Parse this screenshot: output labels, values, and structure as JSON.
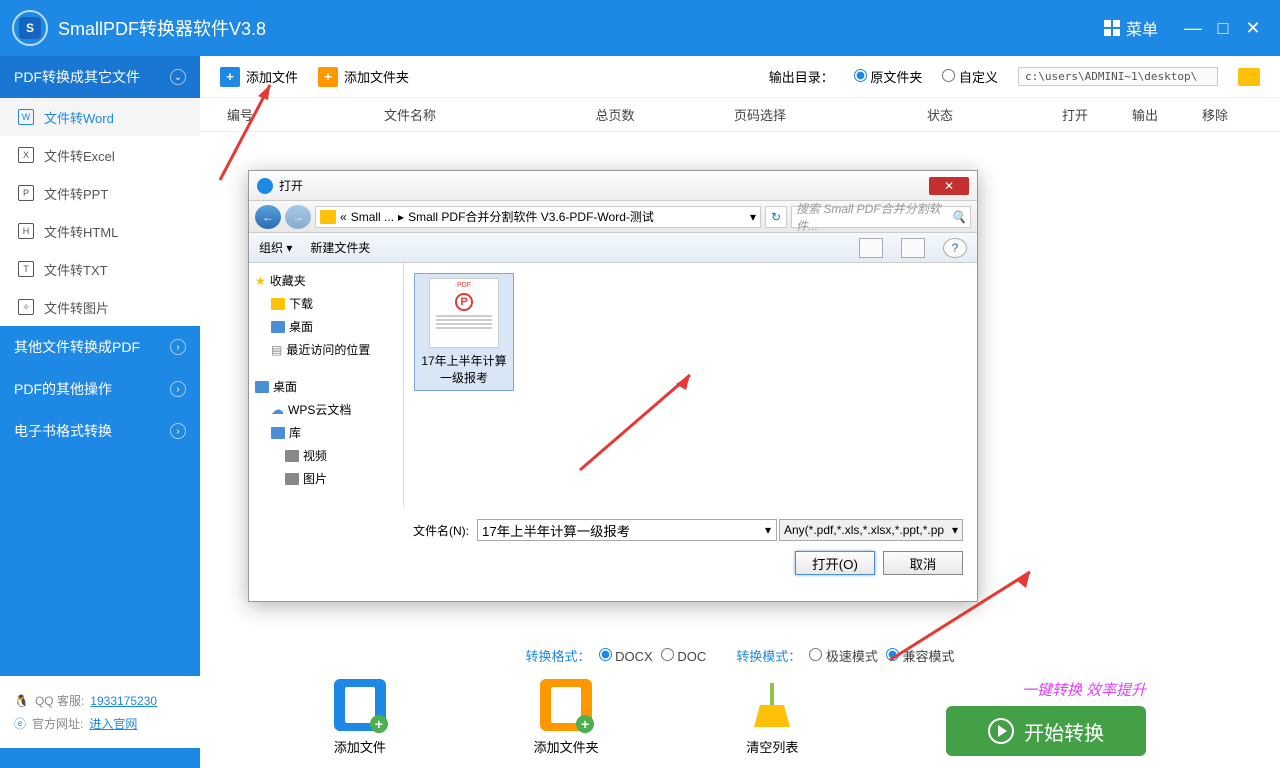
{
  "app": {
    "title": "SmallPDF转换器软件V3.8",
    "menu": "菜单"
  },
  "sidebar": {
    "cat1": "PDF转换成其它文件",
    "items": [
      {
        "label": "文件转Word",
        "glyph": "W"
      },
      {
        "label": "文件转Excel",
        "glyph": "X"
      },
      {
        "label": "文件转PPT",
        "glyph": "P"
      },
      {
        "label": "文件转HTML",
        "glyph": "H"
      },
      {
        "label": "文件转TXT",
        "glyph": "T"
      },
      {
        "label": "文件转图片",
        "glyph": "✧"
      }
    ],
    "cat2": "其他文件转换成PDF",
    "cat3": "PDF的其他操作",
    "cat4": "电子书格式转换",
    "qq_label": "QQ 客服:",
    "qq": "1933175230",
    "site_label": "官方网址:",
    "site": "进入官网"
  },
  "toolbar": {
    "add_file": "添加文件",
    "add_folder": "添加文件夹",
    "output_label": "输出目录：",
    "opt1": "原文件夹",
    "opt2": "自定义",
    "path": "c:\\users\\ADMINI~1\\desktop\\"
  },
  "table": {
    "h1": "编号",
    "h2": "文件名称",
    "h3": "总页数",
    "h4": "页码选择",
    "h5": "状态",
    "h6": "打开",
    "h7": "输出",
    "h8": "移除"
  },
  "dialog": {
    "title": "打开",
    "crumb1": "Small ...",
    "crumb2": "Small PDF合并分割软件 V3.6-PDF-Word-测试",
    "search_placeholder": "搜索 Small PDF合并分割软件...",
    "organize": "组织",
    "new_folder": "新建文件夹",
    "tree": {
      "fav": "收藏夹",
      "downloads": "下载",
      "desktop": "桌面",
      "recent": "最近访问的位置",
      "desktop2": "桌面",
      "wps": "WPS云文档",
      "library": "库",
      "video": "视频",
      "pictures": "图片"
    },
    "file": {
      "name_l1": "17年上半年计算",
      "name_l2": "一级报考"
    },
    "fname_label": "文件名(N):",
    "fname_value": "17年上半年计算一级报考",
    "filter": "Any(*.pdf,*.xls,*.xlsx,*.ppt,*.pp",
    "open": "打开(O)",
    "cancel": "取消"
  },
  "bottom": {
    "fmt_label": "转换格式：",
    "fmt1": "DOCX",
    "fmt2": "DOC",
    "mode_label": "转换模式：",
    "mode1": "极速模式",
    "mode2": "兼容模式",
    "act1": "添加文件",
    "act2": "添加文件夹",
    "act3": "清空列表",
    "eff": "一键转换 效率提升",
    "start": "开始转换"
  }
}
